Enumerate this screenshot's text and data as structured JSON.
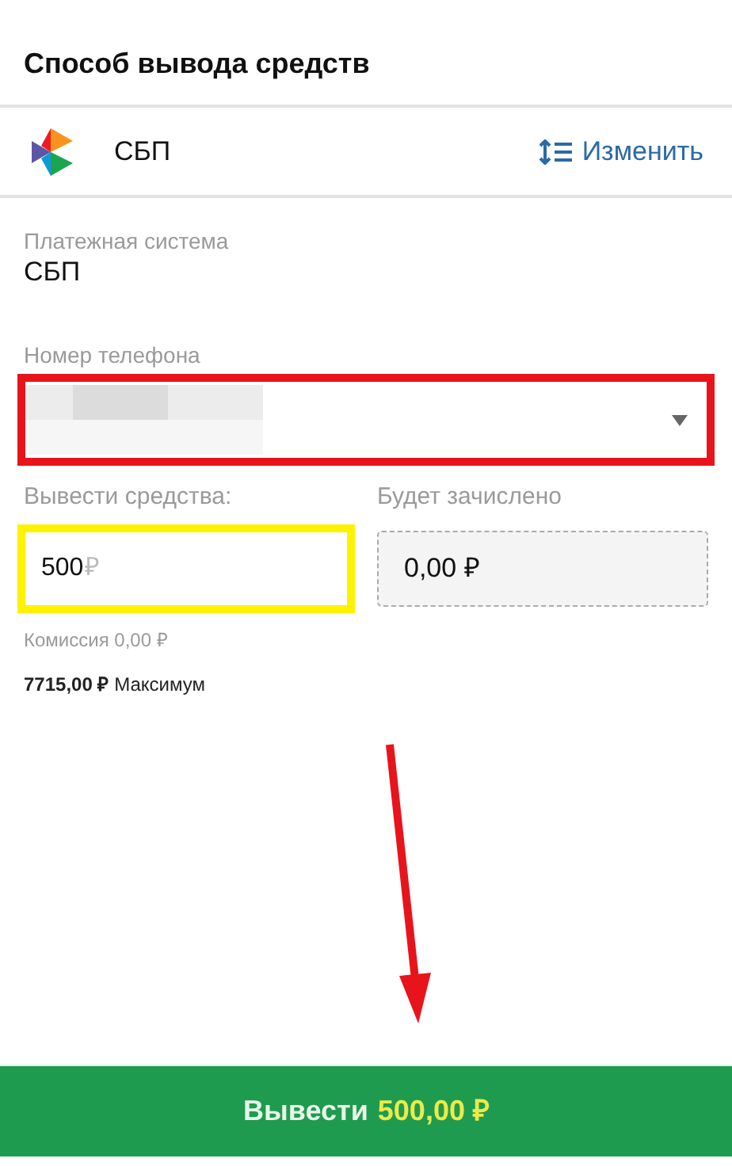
{
  "header": {
    "title": "Способ вывода средств"
  },
  "method": {
    "name": "СБП",
    "change_link": "Изменить"
  },
  "payment_system": {
    "label": "Платежная система",
    "value": "СБП"
  },
  "phone_field": {
    "label": "Номер телефона",
    "redacted": true,
    "color": "#e8141c"
  },
  "withdraw_field": {
    "label": "Вывести средства:",
    "value": "500",
    "currency": "₽",
    "color": "#fff200"
  },
  "credited_field": {
    "label": "Будет зачислено",
    "value": "0,00 ₽"
  },
  "commission": "Комиссия 0,00 ₽",
  "maximum": {
    "amount": "7715,00 ₽",
    "label": "Максимум"
  },
  "annotation_arrow": true,
  "submit_button": {
    "label": "Вывести",
    "amount": "500,00 ₽"
  }
}
